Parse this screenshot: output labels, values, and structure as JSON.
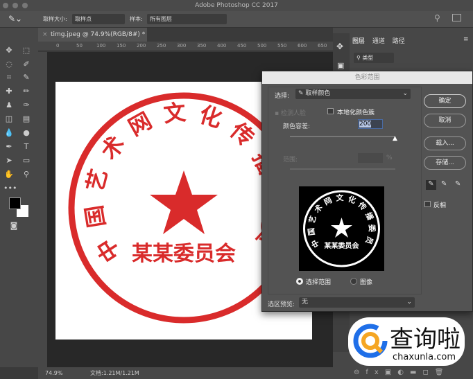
{
  "app": {
    "title": "Adobe Photoshop CC 2017"
  },
  "options": {
    "sample_size_label": "取样大小:",
    "sample_size_value": "取样点",
    "sample_label": "样本:",
    "sample_value": "所有图层"
  },
  "document": {
    "tab_title": "timg.jpeg @ 74.9%(RGB/8#) *",
    "ruler_ticks": [
      "0",
      "50",
      "100",
      "150",
      "200",
      "250",
      "300",
      "350",
      "400",
      "450",
      "500",
      "550",
      "600",
      "650"
    ],
    "zoom": "74.9%",
    "doc_info": "文档:1.21M/1.21M"
  },
  "seal": {
    "outer_text": "中国艺术网文化传播委员会",
    "bottom_text": "某某委员会",
    "color": "#d92b2b"
  },
  "layers_panel": {
    "tabs": [
      "图层",
      "通道",
      "路径"
    ],
    "kind_filter": "类型"
  },
  "dialog": {
    "title": "色彩范围",
    "select_label": "选择:",
    "select_value": "取样颜色",
    "detect_faces": "检测人脸",
    "localized": "本地化颜色簇",
    "fuzziness_label": "颜色容差:",
    "fuzziness_value": "200",
    "fuzziness_percent": 1.0,
    "range_label": "范围:",
    "range_unit": "%",
    "radio_selection": "选择范围",
    "radio_image": "图像",
    "preview_label": "选区预览:",
    "preview_value": "无",
    "ok": "确定",
    "cancel": "取消",
    "load": "载入...",
    "save": "存储...",
    "invert": "反相"
  },
  "watermark": {
    "text": "查询啦",
    "url": "chaxunla.com"
  }
}
